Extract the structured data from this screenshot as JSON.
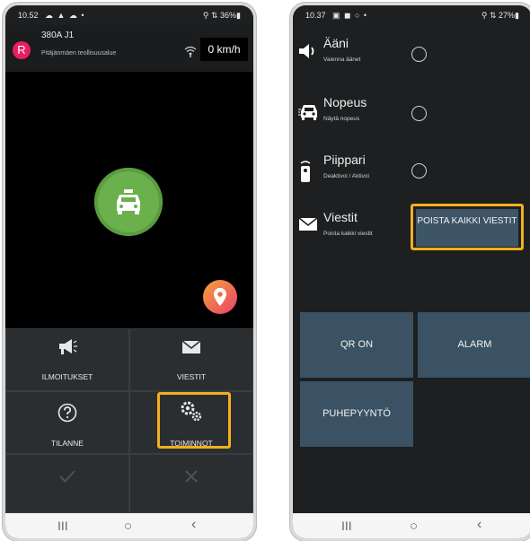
{
  "phone1": {
    "status": {
      "time": "10.52",
      "icons": "☁ ▲ ☁ •",
      "right": "⚲ ⇅ 36%▮"
    },
    "header": {
      "avatar_letter": "R",
      "vehicle_id": "380A J1",
      "location": "Pitäjänmäen teollisuusalue",
      "speed": "0 km/h"
    },
    "grid": {
      "ilmoitukset": "ILMOITUKSET",
      "viestit": "VIESTIT",
      "tilanne": "TILANNE",
      "toiminnot": "TOIMINNOT"
    },
    "nav": {
      "recent": "III",
      "home": "○",
      "back": "‹"
    }
  },
  "phone2": {
    "status": {
      "time": "10.37",
      "icons": "▣ ◼ ○ •",
      "right": "⚲ ⇅ 27%▮"
    },
    "rows": [
      {
        "title": "Ääni",
        "sub": "Vaienna äänet"
      },
      {
        "title": "Nopeus",
        "sub": "Näytä nopeus"
      },
      {
        "title": "Piippari",
        "sub": "Deaktivoi / Aktivoi"
      },
      {
        "title": "Viestit",
        "sub": "Poista kaikki viestit"
      }
    ],
    "poista_button": "POISTA KAIKKI VIESTIT",
    "tiles": {
      "qr": "QR ON",
      "alarm": "ALARM",
      "puhe": "PUHEPYYNTÖ"
    },
    "nav": {
      "recent": "III",
      "home": "○",
      "back": "‹"
    }
  },
  "colors": {
    "highlight": "#f2b01e",
    "taxi_green": "#6ab04c",
    "tile_blue": "#3a5263"
  },
  "icons": [
    "megaphone-icon",
    "envelope-icon",
    "question-circle-icon",
    "gears-icon",
    "check-icon",
    "close-icon",
    "taxi-icon",
    "location-pin-icon",
    "speaker-icon",
    "car-icon",
    "beeper-icon",
    "mail-icon",
    "wifi-icon"
  ]
}
